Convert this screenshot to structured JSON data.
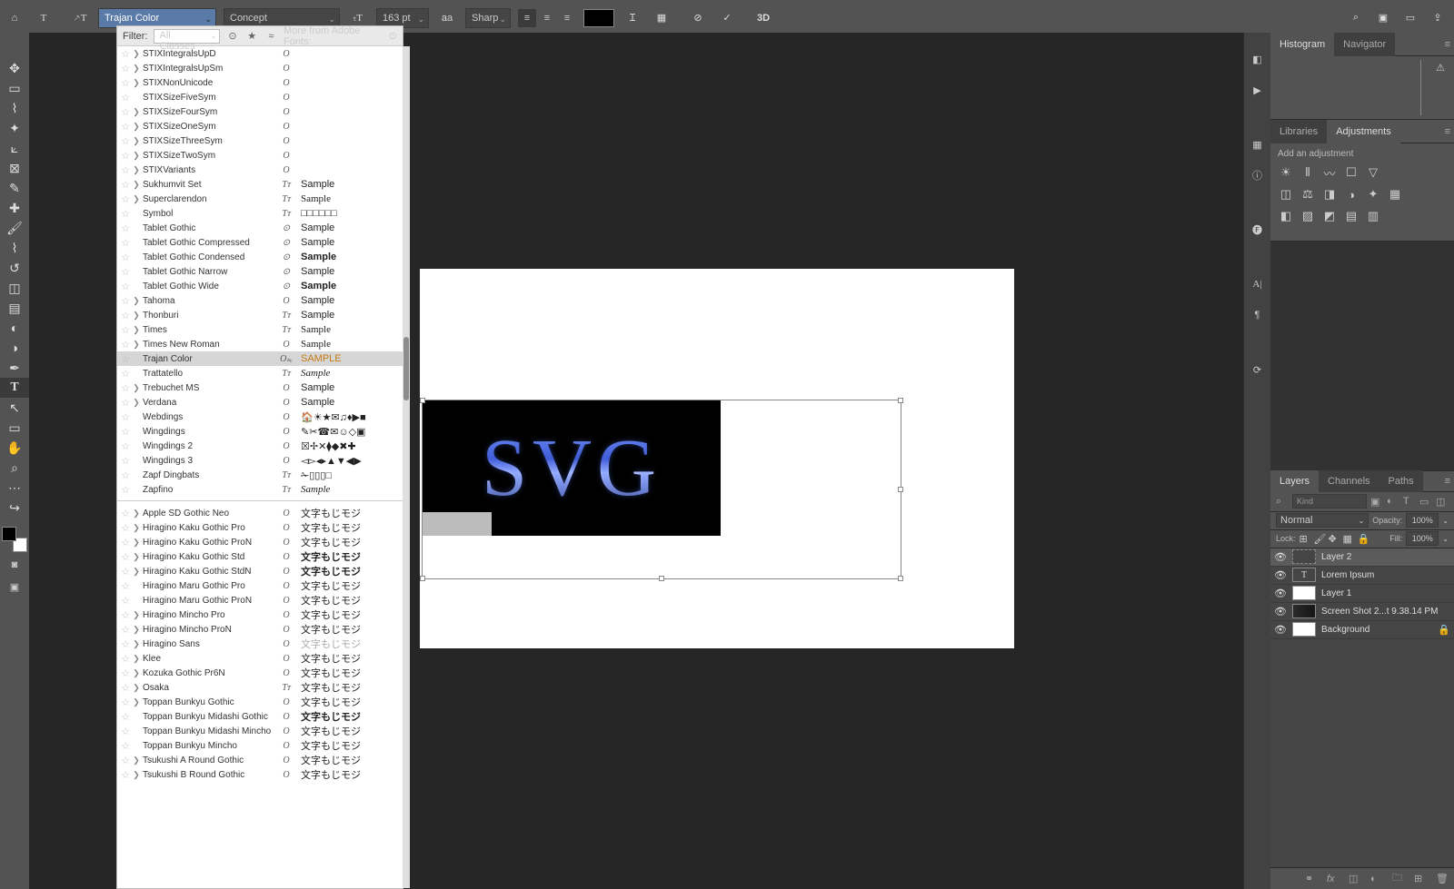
{
  "options": {
    "font": "Trajan Color",
    "style": "Concept",
    "size": "163 pt",
    "aa": "Sharp"
  },
  "fontFilter": {
    "label": "Filter:",
    "classes": "All Classes",
    "adobe": "More from Adobe Fonts:"
  },
  "fonts_a": [
    {
      "n": "STIXIntegralsUpD",
      "k": "O",
      "s": "",
      "exp": "1"
    },
    {
      "n": "STIXIntegralsUpSm",
      "k": "O",
      "s": "",
      "exp": "1"
    },
    {
      "n": "STIXNonUnicode",
      "k": "O",
      "s": "",
      "exp": "1"
    },
    {
      "n": "STIXSizeFiveSym",
      "k": "O",
      "s": "",
      "exp": ""
    },
    {
      "n": "STIXSizeFourSym",
      "k": "O",
      "s": "",
      "exp": "1"
    },
    {
      "n": "STIXSizeOneSym",
      "k": "O",
      "s": "",
      "exp": "1"
    },
    {
      "n": "STIXSizeThreeSym",
      "k": "O",
      "s": "",
      "exp": "1"
    },
    {
      "n": "STIXSizeTwoSym",
      "k": "O",
      "s": "",
      "exp": "1"
    },
    {
      "n": "STIXVariants",
      "k": "O",
      "s": "",
      "exp": "1"
    },
    {
      "n": "Sukhumvit Set",
      "k": "Tᴛ",
      "s": "Sample",
      "exp": "1"
    },
    {
      "n": "Superclarendon",
      "k": "Tᴛ",
      "s": "Sample",
      "cls": "serif",
      "exp": "1"
    },
    {
      "n": "Symbol",
      "k": "Tᴛ",
      "s": "□□□□□□",
      "exp": ""
    },
    {
      "n": "Tablet Gothic",
      "k": "⊙",
      "s": "Sample",
      "exp": ""
    },
    {
      "n": "Tablet Gothic Compressed",
      "k": "⊙",
      "s": "Sample",
      "exp": ""
    },
    {
      "n": "Tablet Gothic Condensed",
      "k": "⊙",
      "s": "Sample",
      "cls": "bold",
      "exp": ""
    },
    {
      "n": "Tablet Gothic Narrow",
      "k": "⊙",
      "s": "Sample",
      "exp": ""
    },
    {
      "n": "Tablet Gothic Wide",
      "k": "⊙",
      "s": "Sample",
      "cls": "bold",
      "exp": ""
    },
    {
      "n": "Tahoma",
      "k": "O",
      "s": "Sample",
      "exp": "1"
    },
    {
      "n": "Thonburi",
      "k": "Tᴛ",
      "s": "Sample",
      "exp": "1"
    },
    {
      "n": "Times",
      "k": "Tᴛ",
      "s": "Sample",
      "cls": "serif",
      "exp": "1"
    },
    {
      "n": "Times New Roman",
      "k": "O",
      "s": "Sample",
      "cls": "serif",
      "exp": "1"
    },
    {
      "n": "Trajan Color",
      "k": "Oₛᵥ",
      "s": "SAMPLE",
      "sel": true,
      "exp": ""
    },
    {
      "n": "Trattatello",
      "k": "Tᴛ",
      "s": "Sample",
      "cls": "serif italic",
      "exp": ""
    },
    {
      "n": "Trebuchet MS",
      "k": "O",
      "s": "Sample",
      "exp": "1"
    },
    {
      "n": "Verdana",
      "k": "O",
      "s": "Sample",
      "exp": "1"
    },
    {
      "n": "Webdings",
      "k": "O",
      "s": "🏠☀★✉♫♦▶■",
      "exp": ""
    },
    {
      "n": "Wingdings",
      "k": "O",
      "s": "✎✂☎✉☺◇▣",
      "exp": ""
    },
    {
      "n": "Wingdings 2",
      "k": "O",
      "s": "☒✢✕⧫◆✖✚",
      "exp": ""
    },
    {
      "n": "Wingdings 3",
      "k": "O",
      "s": "◅▻◂▸▲▼◀▶",
      "exp": ""
    },
    {
      "n": "Zapf Dingbats",
      "k": "Tᴛ",
      "s": "✁▯▯▯□",
      "exp": ""
    },
    {
      "n": "Zapfino",
      "k": "Tᴛ",
      "s": "Sample",
      "cls": "serif italic",
      "exp": ""
    }
  ],
  "fonts_b": [
    {
      "n": "Apple SD Gothic Neo",
      "k": "O",
      "s": "文字もじモジ",
      "exp": "1"
    },
    {
      "n": "Hiragino Kaku Gothic Pro",
      "k": "O",
      "s": "文字もじモジ",
      "exp": "1"
    },
    {
      "n": "Hiragino Kaku Gothic ProN",
      "k": "O",
      "s": "文字もじモジ",
      "exp": "1"
    },
    {
      "n": "Hiragino Kaku Gothic Std",
      "k": "O",
      "s": "文字もじモジ",
      "cls": "bold",
      "exp": "1"
    },
    {
      "n": "Hiragino Kaku Gothic StdN",
      "k": "O",
      "s": "文字もじモジ",
      "cls": "bold",
      "exp": "1"
    },
    {
      "n": "Hiragino Maru Gothic Pro",
      "k": "O",
      "s": "文字もじモジ",
      "exp": ""
    },
    {
      "n": "Hiragino Maru Gothic ProN",
      "k": "O",
      "s": "文字もじモジ",
      "exp": ""
    },
    {
      "n": "Hiragino Mincho Pro",
      "k": "O",
      "s": "文字もじモジ",
      "exp": "1"
    },
    {
      "n": "Hiragino Mincho ProN",
      "k": "O",
      "s": "文字もじモジ",
      "exp": "1"
    },
    {
      "n": "Hiragino Sans",
      "k": "O",
      "s": "文字もじモジ",
      "cls": "gray",
      "exp": "1"
    },
    {
      "n": "Klee",
      "k": "O",
      "s": "文字もじモジ",
      "exp": "1"
    },
    {
      "n": "Kozuka Gothic Pr6N",
      "k": "O",
      "s": "文字もじモジ",
      "exp": "1"
    },
    {
      "n": "Osaka",
      "k": "Tᴛ",
      "s": "文字もじモジ",
      "exp": "1"
    },
    {
      "n": "Toppan Bunkyu Gothic",
      "k": "O",
      "s": "文字もじモジ",
      "exp": "1"
    },
    {
      "n": "Toppan Bunkyu Midashi Gothic",
      "k": "O",
      "s": "文字もじモジ",
      "cls": "bold",
      "exp": ""
    },
    {
      "n": "Toppan Bunkyu Midashi Mincho",
      "k": "O",
      "s": "文字もじモジ",
      "exp": ""
    },
    {
      "n": "Toppan Bunkyu Mincho",
      "k": "O",
      "s": "文字もじモジ",
      "exp": ""
    },
    {
      "n": "Tsukushi A Round Gothic",
      "k": "O",
      "s": "文字もじモジ",
      "exp": "1"
    },
    {
      "n": "Tsukushi B Round Gothic",
      "k": "O",
      "s": "文字もじモジ",
      "exp": "1"
    }
  ],
  "panels": {
    "histogram": "Histogram",
    "navigator": "Navigator",
    "libraries": "Libraries",
    "adjustments": "Adjustments",
    "addadj": "Add an adjustment",
    "layers": "Layers",
    "channels": "Channels",
    "paths": "Paths"
  },
  "layerctrl": {
    "kind": "Kind",
    "blend": "Normal",
    "opacityLabel": "Opacity:",
    "opacity": "100%",
    "lock": "Lock:",
    "fillLabel": "Fill:",
    "fill": "100%"
  },
  "layers": [
    {
      "name": "Layer 2",
      "type": "convert",
      "sel": true
    },
    {
      "name": "Lorem Ipsum",
      "type": "t"
    },
    {
      "name": "Layer 1",
      "type": "bg"
    },
    {
      "name": "Screen Shot 2...t 9.38.14 PM",
      "type": "img"
    },
    {
      "name": "Background",
      "type": "bg",
      "lock": true
    }
  ],
  "canvas": {
    "text": "SVG"
  }
}
